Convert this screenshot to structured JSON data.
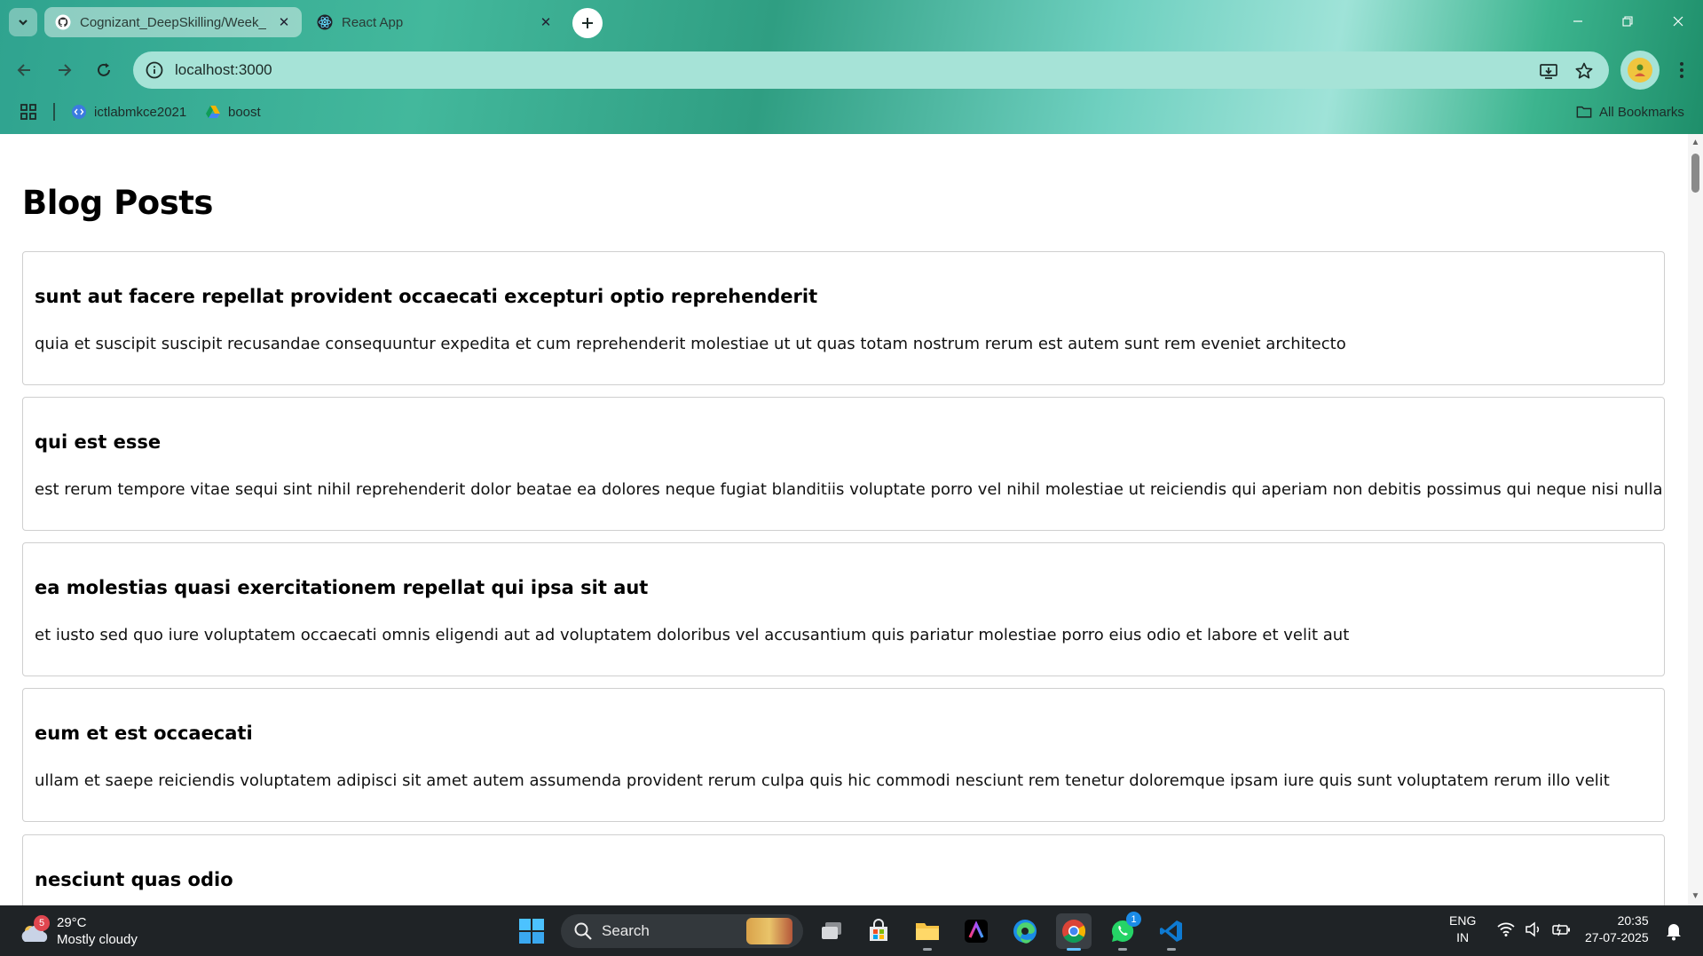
{
  "browser": {
    "tabs": [
      {
        "title": "Cognizant_DeepSkilling/Week_",
        "favicon": "github-icon",
        "active": false
      },
      {
        "title": "React App",
        "favicon": "react-icon",
        "active": true
      }
    ],
    "address": "localhost:3000",
    "bookmarks": [
      {
        "label": "ictlabmkce2021",
        "icon": "code-icon"
      },
      {
        "label": "boost",
        "icon": "google-drive-icon"
      }
    ],
    "all_bookmarks_label": "All Bookmarks"
  },
  "page": {
    "title": "Blog Posts",
    "posts": [
      {
        "title": "sunt aut facere repellat provident occaecati excepturi optio reprehenderit",
        "body": "quia et suscipit suscipit recusandae consequuntur expedita et cum reprehenderit molestiae ut ut quas totam nostrum rerum est autem sunt rem eveniet architecto"
      },
      {
        "title": "qui est esse",
        "body": "est rerum tempore vitae sequi sint nihil reprehenderit dolor beatae ea dolores neque fugiat blanditiis voluptate porro vel nihil molestiae ut reiciendis qui aperiam non debitis possimus qui neque nisi nulla"
      },
      {
        "title": "ea molestias quasi exercitationem repellat qui ipsa sit aut",
        "body": "et iusto sed quo iure voluptatem occaecati omnis eligendi aut ad voluptatem doloribus vel accusantium quis pariatur molestiae porro eius odio et labore et velit aut"
      },
      {
        "title": "eum et est occaecati",
        "body": "ullam et saepe reiciendis voluptatem adipisci sit amet autem assumenda provident rerum culpa quis hic commodi nesciunt rem tenetur doloremque ipsam iure quis sunt voluptatem rerum illo velit"
      },
      {
        "title": "nesciunt quas odio",
        "body": ""
      }
    ]
  },
  "taskbar": {
    "weather": {
      "badge": "5",
      "temp": "29°C",
      "condition": "Mostly cloudy"
    },
    "search_label": "Search",
    "language": {
      "line1": "ENG",
      "line2": "IN"
    },
    "clock": {
      "time": "20:35",
      "date": "27-07-2025"
    },
    "whatsapp_badge": "1"
  },
  "colors": {
    "chrome_accent": "#a6e3d7",
    "taskbar_bg": "#1f2326",
    "card_border": "#cfcfcf"
  }
}
